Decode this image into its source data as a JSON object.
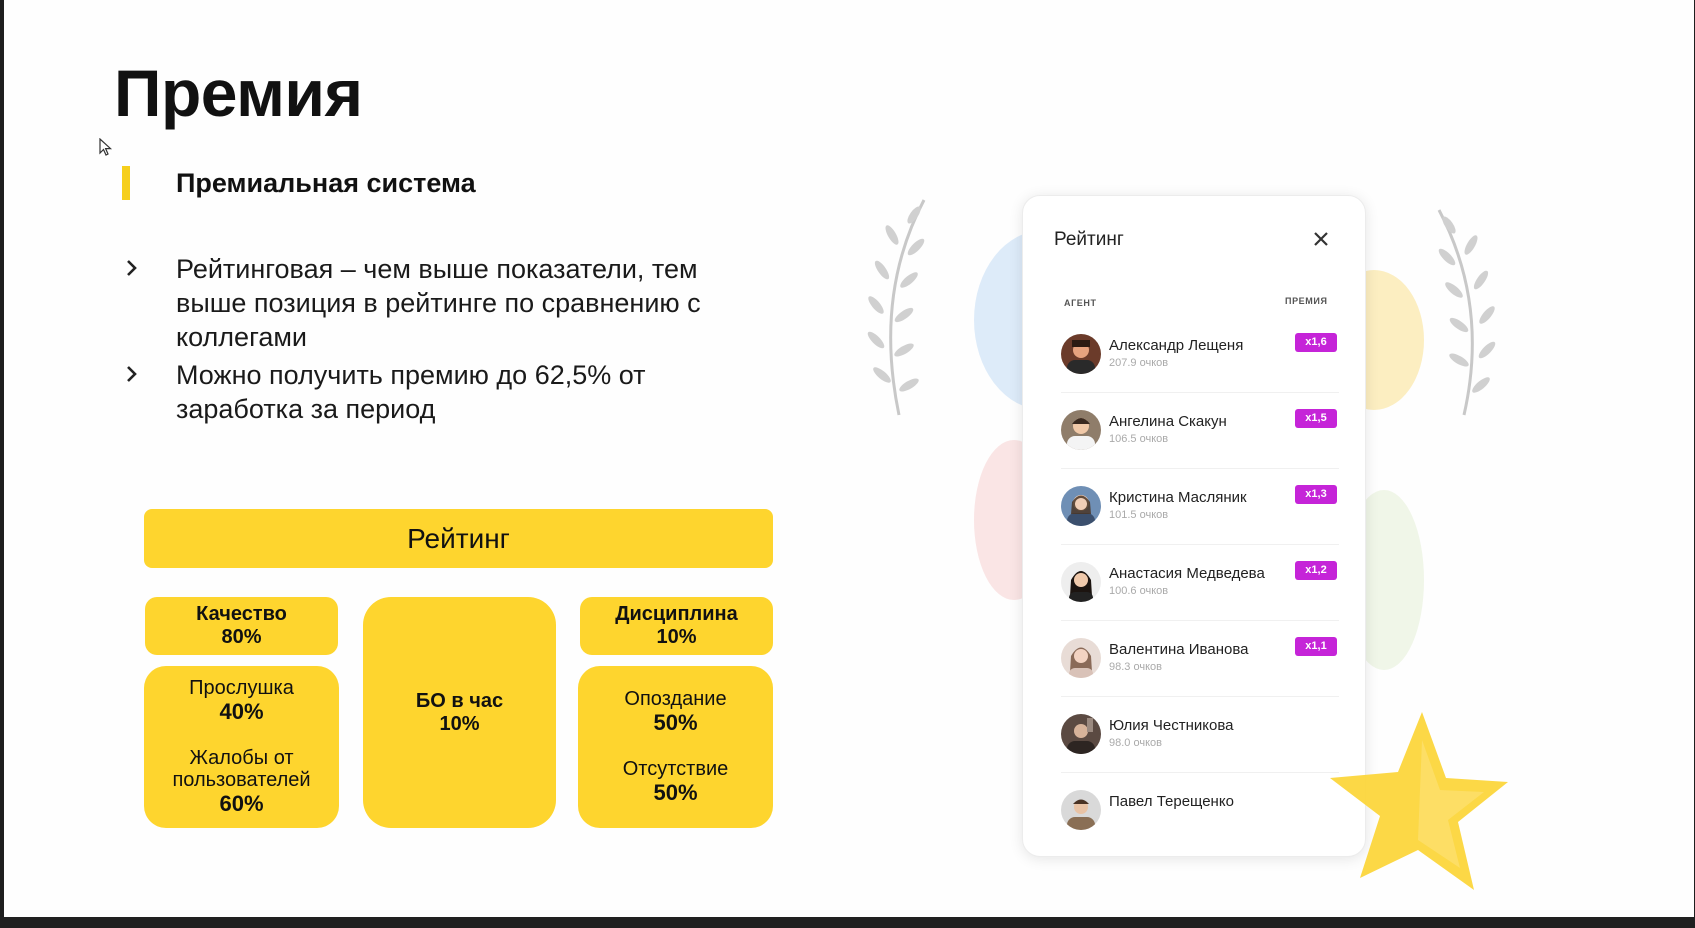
{
  "slide": {
    "title": "Премия",
    "subtitle": "Премиальная система",
    "bullets": [
      "Рейтинговая – чем выше показатели, тем выше позиция в рейтинге по сравнению с коллегами",
      "Можно получить премию до 62,5% от заработка за период"
    ]
  },
  "diagram": {
    "header": "Рейтинг",
    "quality": {
      "title": "Качество",
      "pct": "80%",
      "items": [
        {
          "label": "Прослушка",
          "pct": "40%"
        },
        {
          "label": "Жалобы от пользователей",
          "pct": "60%"
        }
      ]
    },
    "middle": {
      "title": "БО в час",
      "pct": "10%"
    },
    "discipline": {
      "title": "Дисциплина",
      "pct": "10%",
      "items": [
        {
          "label": "Опоздание",
          "pct": "50%"
        },
        {
          "label": "Отсутствие",
          "pct": "50%"
        }
      ]
    }
  },
  "rating_panel": {
    "title": "Рейтинг",
    "col_agent": "АГЕНТ",
    "col_bonus": "ПРЕМИЯ",
    "agents": [
      {
        "name": "Александр Лещеня",
        "points": "207.9 очков",
        "mult": "x1,6"
      },
      {
        "name": "Ангелина Скакун",
        "points": "106.5 очков",
        "mult": "x1,5"
      },
      {
        "name": "Кристина Масляник",
        "points": "101.5 очков",
        "mult": "x1,3"
      },
      {
        "name": "Анастасия Медведева",
        "points": "100.6 очков",
        "mult": "x1,2"
      },
      {
        "name": "Валентина Иванова",
        "points": "98.3 очков",
        "mult": "x1,1"
      },
      {
        "name": "Юлия Честникова",
        "points": "98.0 очков",
        "mult": ""
      },
      {
        "name": "Павел Терещенко",
        "points": "",
        "mult": ""
      }
    ]
  },
  "colors": {
    "accent_yellow": "#f6cf1c",
    "block_yellow": "#fed52e",
    "badge_magenta": "#c524d8"
  },
  "icons": [
    "cursor-icon",
    "chevron-right-icon",
    "close-icon",
    "laurel-icon",
    "star-icon"
  ]
}
